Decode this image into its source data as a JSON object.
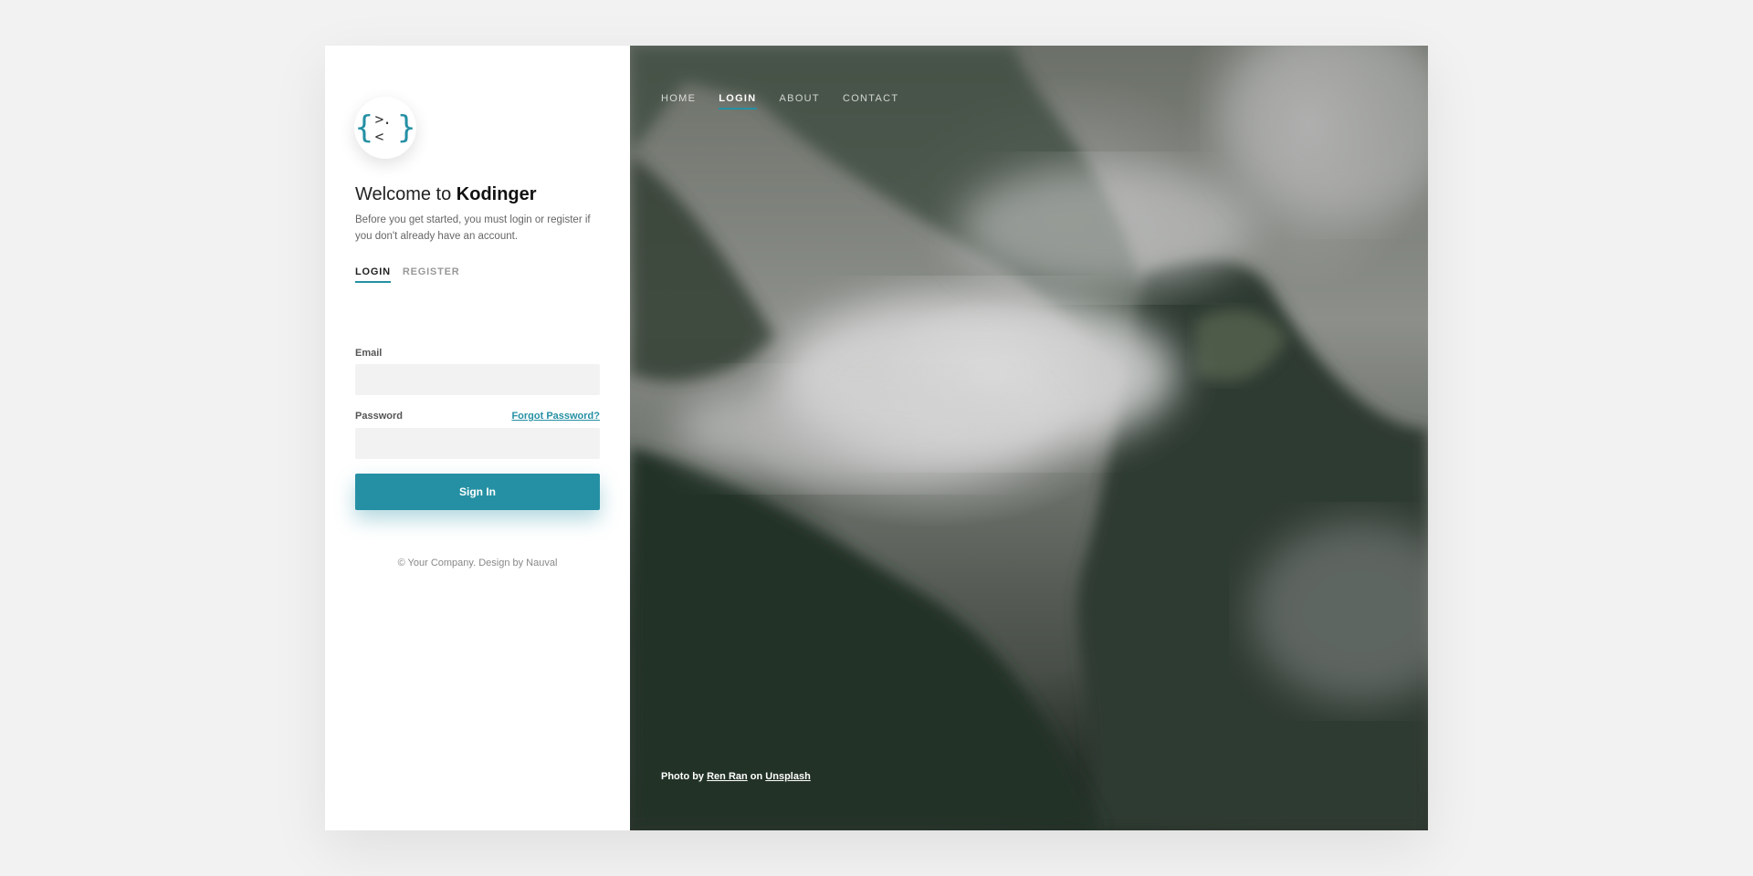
{
  "brand": {
    "logo_left_brace": "{",
    "logo_face": ">.<",
    "logo_right_brace": "}",
    "accent_color": "#2590a4"
  },
  "welcome": {
    "prefix": "Welcome to ",
    "name": "Kodinger",
    "intro": "Before you get started, you must login or register if you don't already have an account."
  },
  "tabs": [
    {
      "label": "LOGIN",
      "active": true
    },
    {
      "label": "REGISTER",
      "active": false
    }
  ],
  "form": {
    "email_label": "Email",
    "email_value": "",
    "password_label": "Password",
    "password_value": "",
    "forgot_label": "Forgot Password?",
    "signin_label": "Sign In"
  },
  "footer": "© Your Company. Design by Nauval",
  "nav": [
    {
      "label": "HOME",
      "active": false
    },
    {
      "label": "LOGIN",
      "active": true
    },
    {
      "label": "ABOUT",
      "active": false
    },
    {
      "label": "CONTACT",
      "active": false
    }
  ],
  "credit": {
    "prefix": "Photo by ",
    "author": "Ren Ran",
    "middle": " on ",
    "site": "Unsplash"
  }
}
